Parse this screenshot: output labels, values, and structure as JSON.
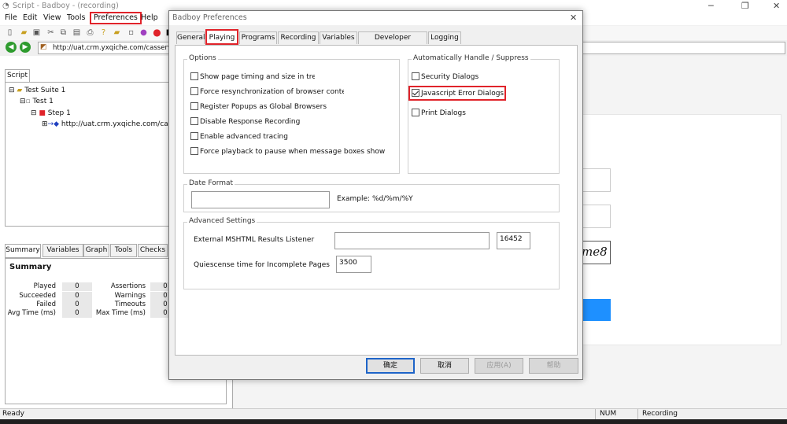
{
  "app": {
    "title": "Script - Badboy - (recording)"
  },
  "menu": [
    "File",
    "Edit",
    "View",
    "Tools",
    "Preferences",
    "Help"
  ],
  "address": {
    "url": "http://uat.crm.yxqiche.com/casserver/logi"
  },
  "script_tab": "Script",
  "tree": {
    "suite": "Test Suite 1",
    "test": "Test 1",
    "step": "Step 1",
    "url": "http://uat.crm.yxqiche.com/casse"
  },
  "bottom_tabs": [
    "Summary",
    "Variables",
    "Graph",
    "Tools",
    "Checks"
  ],
  "summary": {
    "title": "Summary",
    "left": [
      {
        "label": "Played",
        "value": "0"
      },
      {
        "label": "Succeeded",
        "value": "0"
      },
      {
        "label": "Failed",
        "value": "0"
      },
      {
        "label": "Avg Time (ms)",
        "value": "0"
      }
    ],
    "right": [
      {
        "label": "Assertions",
        "value": "0"
      },
      {
        "label": "Warnings",
        "value": "0"
      },
      {
        "label": "Timeouts",
        "value": "0"
      },
      {
        "label": "Max Time (ms)",
        "value": "0"
      }
    ]
  },
  "browser_fragment": {
    "captcha_text": "me8"
  },
  "status": {
    "left": "Ready",
    "num": "NUM",
    "mode": "Recording"
  },
  "dialog": {
    "title": "Badboy Preferences",
    "tabs": [
      "General",
      "Playing",
      "Programs",
      "Recording",
      "Variables",
      "Developer Settings",
      "Logging"
    ],
    "options_group": "Options",
    "options": [
      {
        "label": "Show page timing and size in tree",
        "checked": false
      },
      {
        "label": "Force resynchronization of browser content",
        "checked": false
      },
      {
        "label": "Register Popups as Global Browsers",
        "checked": false
      },
      {
        "label": "Disable Response Recording",
        "checked": false
      },
      {
        "label": "Enable advanced tracing",
        "checked": false
      },
      {
        "label": "Force playback to pause when message boxes show",
        "checked": false
      }
    ],
    "auto_group": "Automatically Handle / Suppress",
    "auto": [
      {
        "label": "Security Dialogs",
        "checked": false
      },
      {
        "label": "Javascript Error Dialogs",
        "checked": true
      },
      {
        "label": "Print Dialogs",
        "checked": false
      }
    ],
    "date_group": "Date Format",
    "date_value": "",
    "date_example": "Example: %d/%m/%Y",
    "adv_group": "Advanced Settings",
    "listener_label": "External MSHTML Results Listener",
    "listener_value": "",
    "port_value": "16452",
    "quiescence_label": "Quiescense time for Incomplete Pages",
    "quiescence_value": "3500",
    "buttons": {
      "ok": "确定",
      "cancel": "取消",
      "apply": "应用(A)",
      "help": "帮助"
    }
  },
  "colors": {
    "highlight": "#e0232a",
    "accent": "#1e64c8",
    "browser_button": "#1e90ff"
  }
}
